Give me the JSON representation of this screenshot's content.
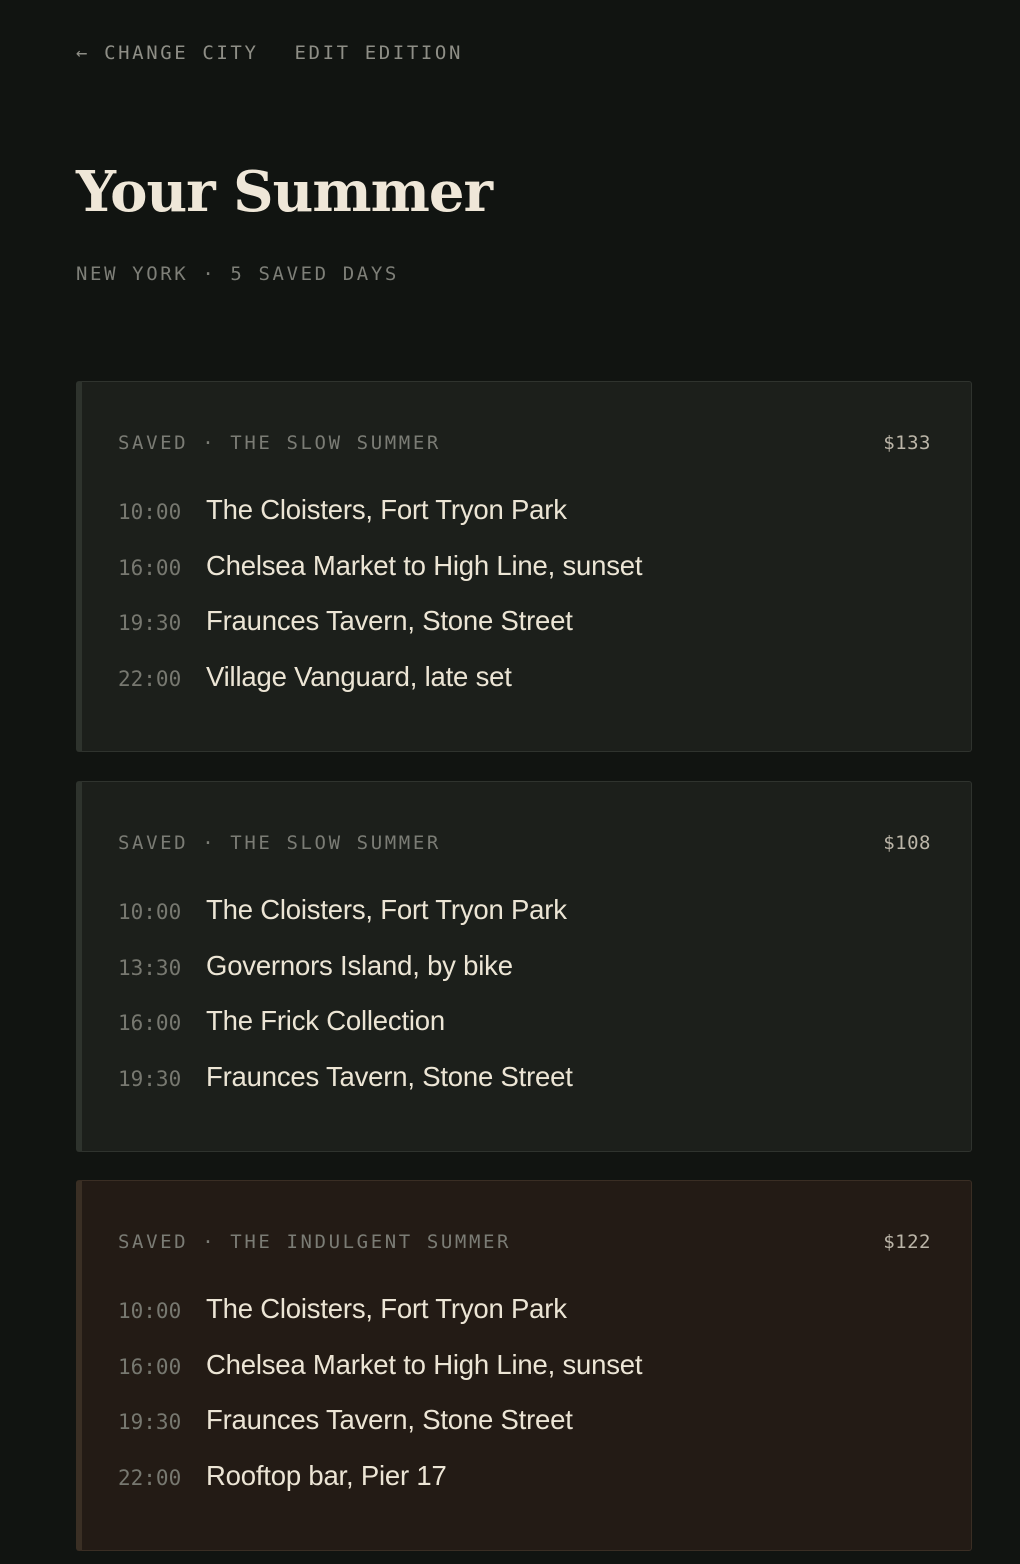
{
  "nav": {
    "change_city": "← CHANGE CITY",
    "edit_edition": "EDIT EDITION"
  },
  "header": {
    "title": "Your Summer",
    "subtitle": "NEW YORK · 5 SAVED DAYS"
  },
  "cards": [
    {
      "label": "SAVED · THE SLOW SUMMER",
      "price": "$133",
      "stops": [
        {
          "time": "10:00",
          "name": "The Cloisters, Fort Tryon Park"
        },
        {
          "time": "16:00",
          "name": "Chelsea Market to High Line, sunset"
        },
        {
          "time": "19:30",
          "name": "Fraunces Tavern, Stone Street"
        },
        {
          "time": "22:00",
          "name": "Village Vanguard, late set"
        }
      ]
    },
    {
      "label": "SAVED · THE SLOW SUMMER",
      "price": "$108",
      "stops": [
        {
          "time": "10:00",
          "name": "The Cloisters, Fort Tryon Park"
        },
        {
          "time": "13:30",
          "name": "Governors Island, by bike"
        },
        {
          "time": "16:00",
          "name": "The Frick Collection"
        },
        {
          "time": "19:30",
          "name": "Fraunces Tavern, Stone Street"
        }
      ]
    },
    {
      "label": "SAVED · THE INDULGENT SUMMER",
      "price": "$122",
      "stops": [
        {
          "time": "10:00",
          "name": "The Cloisters, Fort Tryon Park"
        },
        {
          "time": "16:00",
          "name": "Chelsea Market to High Line, sunset"
        },
        {
          "time": "19:30",
          "name": "Fraunces Tavern, Stone Street"
        },
        {
          "time": "22:00",
          "name": "Rooftop bar, Pier 17"
        }
      ]
    }
  ],
  "colors": {
    "background": "#111411",
    "card_slow": "#1c1f1b",
    "card_indulgent": "#231b15",
    "text_primary": "#ece5d5",
    "text_muted": "#7b7c75"
  }
}
